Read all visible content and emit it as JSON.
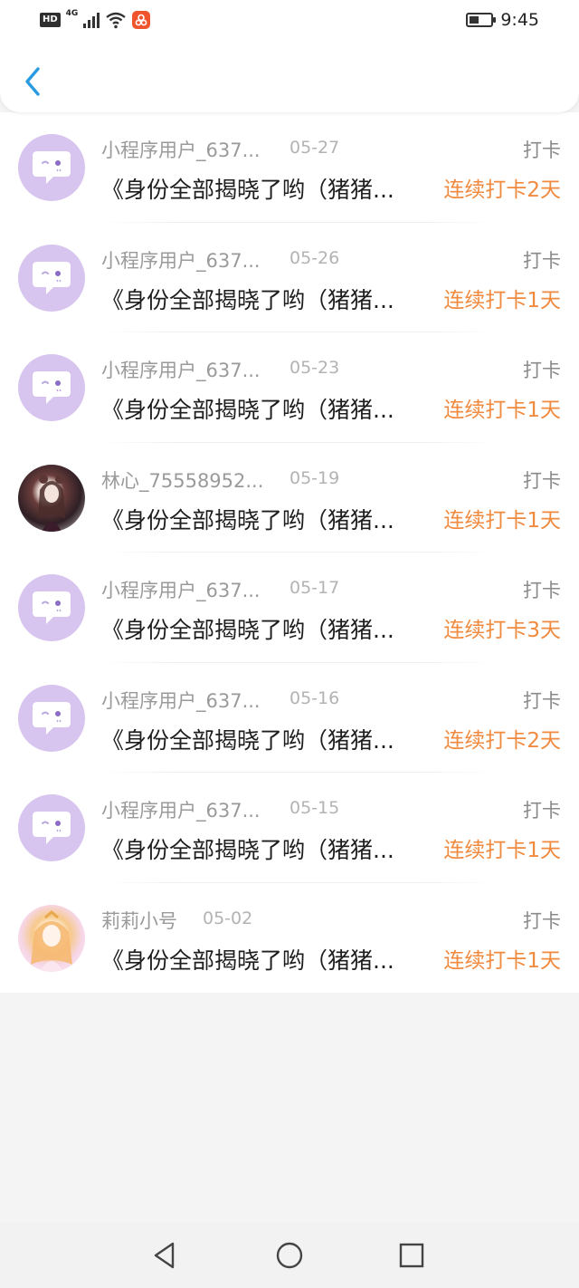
{
  "status_bar": {
    "hd": "HD",
    "network": "4G",
    "time": "9:45"
  },
  "header": {
    "back_icon": "chevron-left-icon",
    "accent": "#2a9be0"
  },
  "colors": {
    "streak": "#f08a3f",
    "avatar_default": "#d7c5ef"
  },
  "items": [
    {
      "name": "小程序用户_637...",
      "date": "05-27",
      "type": "打卡",
      "title": "《身份全部揭晓了哟（猪猪...",
      "streak": "连续打卡2天",
      "avatar": "default"
    },
    {
      "name": "小程序用户_637...",
      "date": "05-26",
      "type": "打卡",
      "title": "《身份全部揭晓了哟（猪猪...",
      "streak": "连续打卡1天",
      "avatar": "default"
    },
    {
      "name": "小程序用户_637...",
      "date": "05-23",
      "type": "打卡",
      "title": "《身份全部揭晓了哟（猪猪...",
      "streak": "连续打卡1天",
      "avatar": "default"
    },
    {
      "name": "林心_75558952...",
      "date": "05-19",
      "type": "打卡",
      "title": "《身份全部揭晓了哟（猪猪...",
      "streak": "连续打卡1天",
      "avatar": "photo"
    },
    {
      "name": "小程序用户_637...",
      "date": "05-17",
      "type": "打卡",
      "title": "《身份全部揭晓了哟（猪猪...",
      "streak": "连续打卡3天",
      "avatar": "default"
    },
    {
      "name": "小程序用户_637...",
      "date": "05-16",
      "type": "打卡",
      "title": "《身份全部揭晓了哟（猪猪...",
      "streak": "连续打卡2天",
      "avatar": "default"
    },
    {
      "name": "小程序用户_637...",
      "date": "05-15",
      "type": "打卡",
      "title": "《身份全部揭晓了哟（猪猪...",
      "streak": "连续打卡1天",
      "avatar": "default"
    },
    {
      "name": "莉莉小号",
      "date": "05-02",
      "type": "打卡",
      "title": "《身份全部揭晓了哟（猪猪...",
      "streak": "连续打卡1天",
      "avatar": "photo"
    }
  ],
  "nav": {
    "back": "triangle-back-icon",
    "home": "circle-home-icon",
    "recents": "square-recents-icon"
  }
}
